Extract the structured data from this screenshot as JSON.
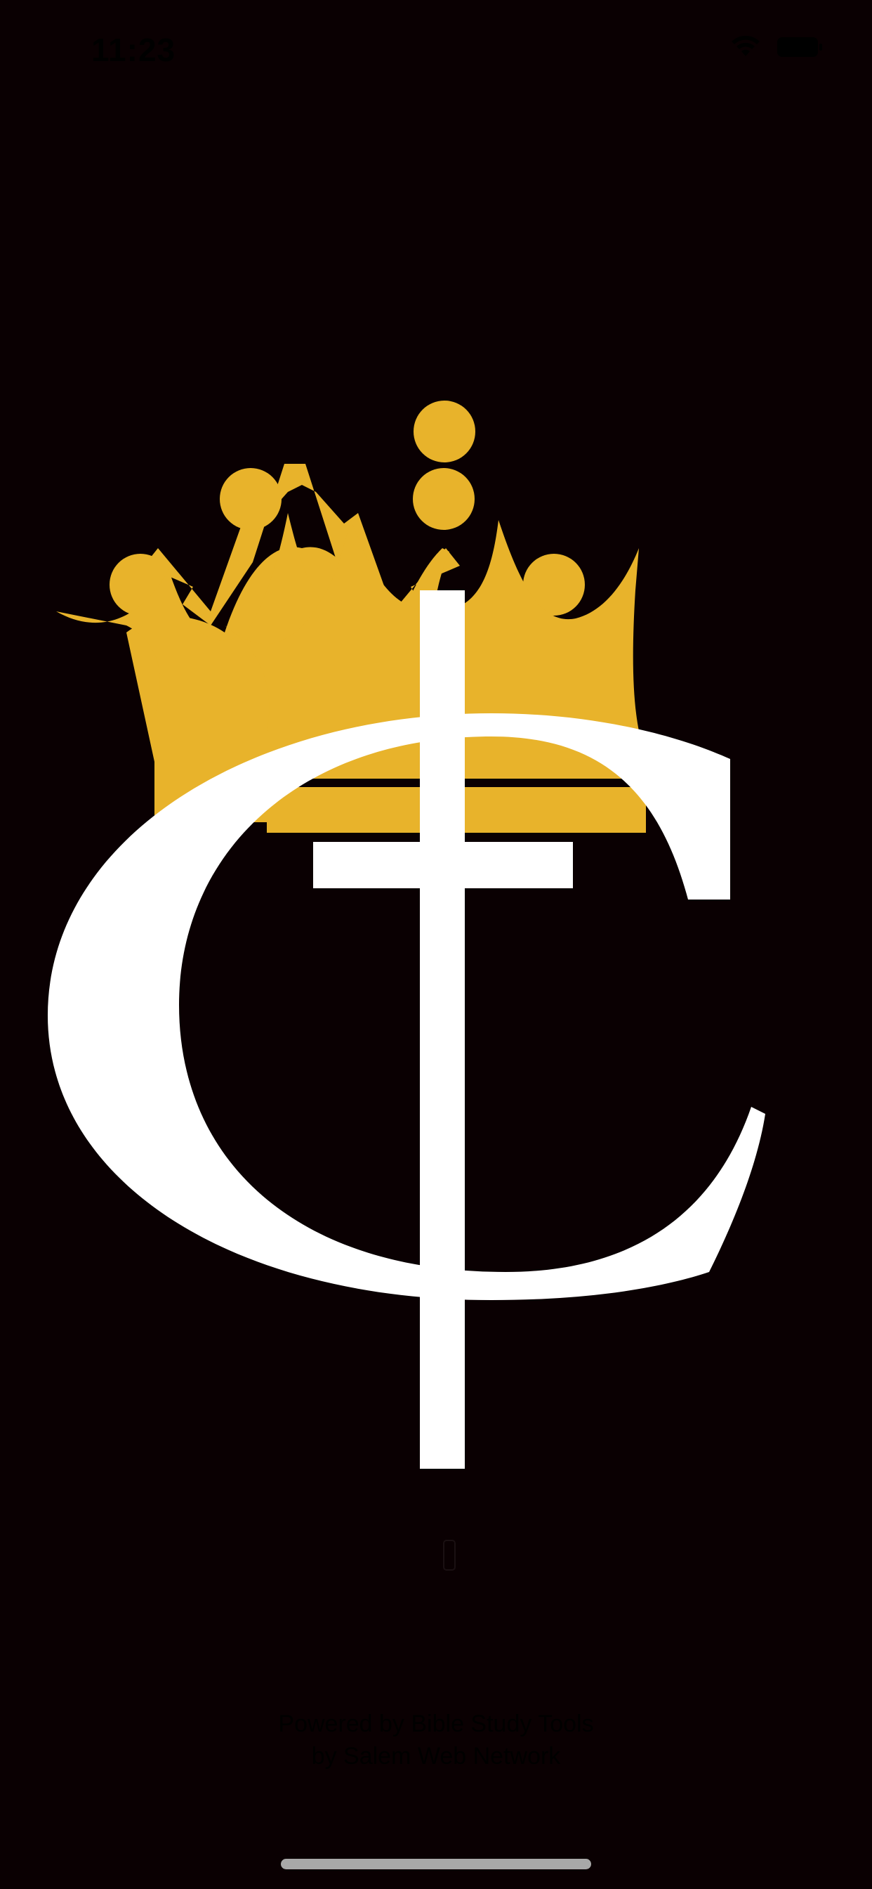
{
  "status_bar": {
    "time": "11:23",
    "icons": [
      "wifi-icon",
      "battery-icon"
    ]
  },
  "logo": {
    "icon": "crown-cross-c-logo",
    "colors": {
      "background": "#0a0002",
      "crown": "#e8b32b",
      "letter": "#ffffff",
      "cross": "#ffffff"
    }
  },
  "loading": {
    "icon": "loading-indicator-icon"
  },
  "footer": {
    "line1": "Powered by Bible Study Tools",
    "line2": "by Salem Web Network"
  },
  "colors": {
    "background": "#0a0002",
    "accent": "#e8b32b",
    "home_indicator": "#a8a8a8"
  }
}
